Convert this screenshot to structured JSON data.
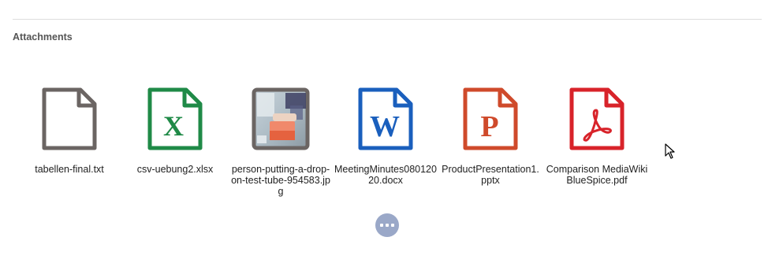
{
  "section": {
    "title": "Attachments"
  },
  "attachments": [
    {
      "name": "tabellen-final.txt",
      "icon": "txt-file-icon",
      "color": "#6b6563"
    },
    {
      "name": "csv-uebung2.xlsx",
      "icon": "excel-file-icon",
      "color": "#1f8a47",
      "glyph": "X"
    },
    {
      "name": "person-putting-a-drop-on-test-tube-954583.jpg",
      "icon": "image-thumbnail-icon",
      "color": "#6b6563"
    },
    {
      "name": "MeetingMinutes08012020.docx",
      "icon": "word-file-icon",
      "color": "#1a5fbd",
      "glyph": "W"
    },
    {
      "name": "ProductPresentation1.pptx",
      "icon": "powerpoint-file-icon",
      "color": "#cf4a2b",
      "glyph": "P"
    },
    {
      "name": "Comparison MediaWiki BlueSpice.pdf",
      "icon": "pdf-file-icon",
      "color": "#d8232a"
    }
  ],
  "more": {
    "icon": "more-dots-icon"
  }
}
